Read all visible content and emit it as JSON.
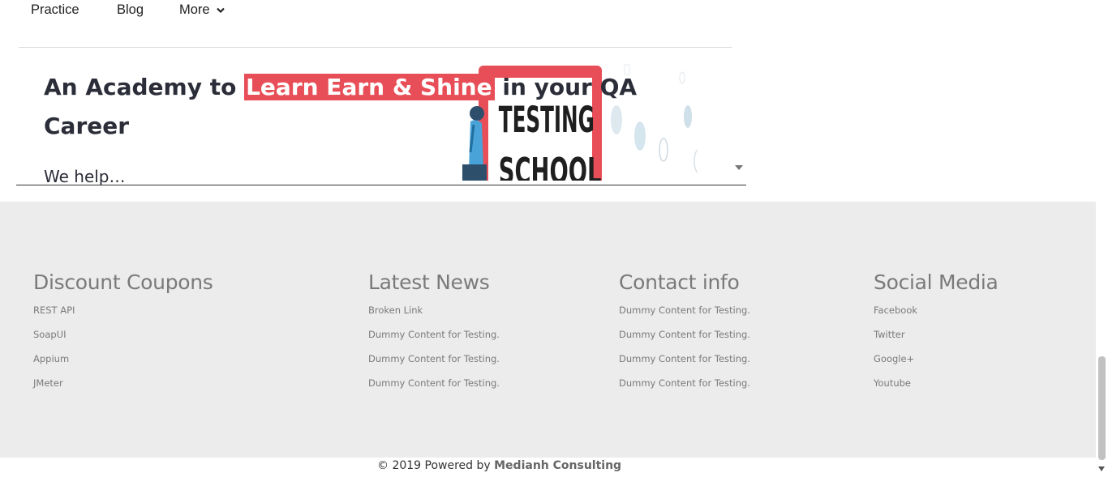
{
  "nav": {
    "items": [
      "Practice",
      "Blog",
      "More"
    ]
  },
  "hero": {
    "title_before": "An Academy to",
    "title_highlight": "Learn Earn & Shine",
    "title_after": "in your QA Career",
    "subtitle_partial": "We help…",
    "image_text": "TESTING SCHOOL",
    "highlight_color": "#e84e57"
  },
  "footer": {
    "columns": [
      {
        "heading": "Discount Coupons",
        "links": [
          "REST API",
          "SoapUI",
          "Appium",
          "JMeter"
        ]
      },
      {
        "heading": "Latest News",
        "links": [
          "Broken Link",
          "Dummy Content for Testing.",
          "Dummy Content for Testing.",
          "Dummy Content for Testing."
        ]
      },
      {
        "heading": "Contact info",
        "links": [
          "Dummy Content for Testing.",
          "Dummy Content for Testing.",
          "Dummy Content for Testing.",
          "Dummy Content for Testing."
        ]
      },
      {
        "heading": "Social Media",
        "links": [
          "Facebook",
          "Twitter",
          "Google+",
          "Youtube"
        ]
      }
    ],
    "copyright_prefix": "© 2019 Powered by",
    "copyright_brand": "Medianh Consulting"
  },
  "icons": {
    "more_dropdown": "chevron-down-icon"
  }
}
